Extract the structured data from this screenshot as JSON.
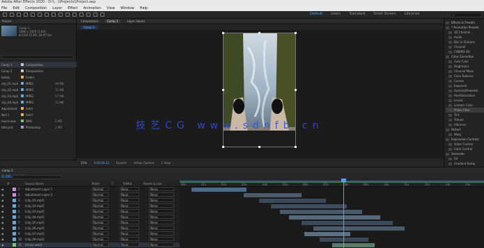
{
  "window": {
    "title": "Adobe After Effects 2020 - D:\\\\...\\\\Projects\\\\Project.aep"
  },
  "menu": [
    "File",
    "Edit",
    "Composition",
    "Layer",
    "Effect",
    "Animation",
    "View",
    "Window",
    "Help"
  ],
  "workspaces": [
    "Default",
    "Learn",
    "Standard",
    "Small Screen",
    "Libraries"
  ],
  "project_panel": {
    "tab": "Project",
    "comp_name": "Comp 1",
    "comp_info": [
      "1080 x 1920 (1.00)",
      "Δ 0:00:15:00, 29.97 fps"
    ],
    "rows": [
      {
        "name": "Comp 1",
        "type": "Composition",
        "size": "",
        "color": "#c9c9c9"
      },
      {
        "name": "Comp 2",
        "type": "Composition",
        "size": "",
        "color": "#c9c9c9"
      },
      {
        "name": "Solids",
        "type": "Folder",
        "size": "",
        "color": "#e0b84a"
      },
      {
        "name": "clip_01.mp4",
        "type": "MPEG",
        "size": "48 MB",
        "color": "#6aa7d6"
      },
      {
        "name": "clip_02.mp4",
        "type": "MPEG",
        "size": "31 MB",
        "color": "#6aa7d6"
      },
      {
        "name": "clip_03.mp4",
        "type": "MPEG",
        "size": "27 MB",
        "color": "#6aa7d6"
      },
      {
        "name": "clip_04.mp4",
        "type": "MPEG",
        "size": "12 MB",
        "color": "#6aa7d6"
      },
      {
        "name": "Adjustment",
        "type": "Solid",
        "size": "",
        "color": "#e0b84a"
      },
      {
        "name": "Null 1",
        "type": "Solid",
        "size": "",
        "color": "#e0b84a"
      },
      {
        "name": "music.wav",
        "type": "WAV",
        "size": "5 MB",
        "color": "#7cc07c"
      },
      {
        "name": "title.psd",
        "type": "Photoshop",
        "size": "2 MB",
        "color": "#c48fd6"
      }
    ]
  },
  "composition": {
    "tabs": [
      "Composition",
      "Comp 1",
      "Layer (none)"
    ],
    "active_tab": "Comp 1",
    "subtab": "Comp 1",
    "zoom": "25%",
    "quality": "Quarter",
    "timecode": "0:00:06:12",
    "camera": "Active Camera",
    "views": "1 View"
  },
  "watermark": "技艺CG www.sdnfb.cn",
  "effects_panel": {
    "items": [
      {
        "label": "Effects & Presets",
        "cat": true
      },
      {
        "label": "* Animation Presets",
        "cat": true
      },
      {
        "label": "3D Channel",
        "cat": false
      },
      {
        "label": "Audio",
        "cat": false
      },
      {
        "label": "Blur & Sharpen",
        "cat": false
      },
      {
        "label": "Channel",
        "cat": false
      },
      {
        "label": "CINEMA 4D",
        "cat": false
      },
      {
        "label": "Color Correction",
        "cat": true
      },
      {
        "label": "Auto Color",
        "cat": false
      },
      {
        "label": "Brightness",
        "cat": false
      },
      {
        "label": "Channel Mixer",
        "cat": false
      },
      {
        "label": "Color Balance",
        "cat": false
      },
      {
        "label": "Curves",
        "cat": false
      },
      {
        "label": "Exposure",
        "cat": false
      },
      {
        "label": "Gamma/Pedestal",
        "cat": false
      },
      {
        "label": "Hue/Saturation",
        "cat": false
      },
      {
        "label": "Levels",
        "cat": false
      },
      {
        "label": "Lumetri Color",
        "cat": false
      },
      {
        "label": "Photo Filter",
        "cat": false
      },
      {
        "label": "Tint",
        "cat": false
      },
      {
        "label": "Tritone",
        "cat": false
      },
      {
        "label": "Vibrance",
        "cat": false
      },
      {
        "label": "Distort",
        "cat": true
      },
      {
        "label": "Warp",
        "cat": false
      },
      {
        "label": "Expression Controls",
        "cat": true
      },
      {
        "label": "Slider Control",
        "cat": false
      },
      {
        "label": "Color Control",
        "cat": false
      },
      {
        "label": "Generate",
        "cat": true
      },
      {
        "label": "Fill",
        "cat": false
      },
      {
        "label": "Gradient Ramp",
        "cat": false
      }
    ]
  },
  "timeline": {
    "tab": "Comp 1",
    "timecode": "0:00:06:12",
    "columns": [
      "#",
      "Source Name",
      "Mode",
      "T",
      "TrkMat",
      "Parent & Link"
    ],
    "ruler_ticks": [
      "00s",
      "01s",
      "02s",
      "03s",
      "04s",
      "05s",
      "06s",
      "07s",
      "08s",
      "09s",
      "10s",
      "11s",
      "12s",
      "13s",
      "14s"
    ],
    "layers": [
      {
        "num": "1",
        "name": "Adjustment Layer 1",
        "mode": "Normal",
        "trk": "None",
        "parent": "None",
        "color": "#c48fd6",
        "start": 0.04,
        "end": 0.22,
        "bar": "#4a6a8a"
      },
      {
        "num": "2",
        "name": "Adjustment Layer 2",
        "mode": "Normal",
        "trk": "None",
        "parent": "None",
        "color": "#c48fd6",
        "start": 0.21,
        "end": 0.4,
        "bar": "#4a5a6a"
      },
      {
        "num": "3",
        "name": "[clip_01.mp4]",
        "mode": "Normal",
        "trk": "None",
        "parent": "None",
        "color": "#6aa7d6",
        "start": 0.26,
        "end": 0.48,
        "bar": "#3a4a5a"
      },
      {
        "num": "4",
        "name": "[clip_02.mp4]",
        "mode": "Normal",
        "trk": "None",
        "parent": "None",
        "color": "#6aa7d6",
        "start": 0.3,
        "end": 0.55,
        "bar": "#3d4d5d"
      },
      {
        "num": "5",
        "name": "[clip_03.mp4]",
        "mode": "Normal",
        "trk": "None",
        "parent": "None",
        "color": "#6aa7d6",
        "start": 0.33,
        "end": 0.6,
        "bar": "#4a5a6a"
      },
      {
        "num": "6",
        "name": "[clip_04.mp4]",
        "mode": "Normal",
        "trk": "None",
        "parent": "None",
        "color": "#6aa7d6",
        "start": 0.36,
        "end": 0.66,
        "bar": "#556a7a"
      },
      {
        "num": "7",
        "name": "[clip_05.mp4]",
        "mode": "Normal",
        "trk": "None",
        "parent": "None",
        "color": "#6aa7d6",
        "start": 0.4,
        "end": 0.7,
        "bar": "#3a4a5a"
      },
      {
        "num": "8",
        "name": "[clip_06.mp4]",
        "mode": "Normal",
        "trk": "None",
        "parent": "None",
        "color": "#6aa7d6",
        "start": 0.44,
        "end": 0.74,
        "bar": "#4a5a6a"
      },
      {
        "num": "9",
        "name": "[clip_07.mp4]",
        "mode": "Normal",
        "trk": "None",
        "parent": "None",
        "color": "#6aa7d6",
        "start": 0.41,
        "end": 0.56,
        "bar": "#5a7080"
      },
      {
        "num": "10",
        "name": "[clip_08.mp4]",
        "mode": "Normal",
        "trk": "None",
        "parent": "None",
        "color": "#6aa7d6",
        "start": 0.46,
        "end": 0.62,
        "bar": "#3a4a5a"
      },
      {
        "num": "11",
        "name": "[music.wav]",
        "mode": "Normal",
        "trk": "None",
        "parent": "None",
        "color": "#7cc07c",
        "start": 0.5,
        "end": 0.64,
        "bar": "#5a7a6a"
      }
    ]
  }
}
